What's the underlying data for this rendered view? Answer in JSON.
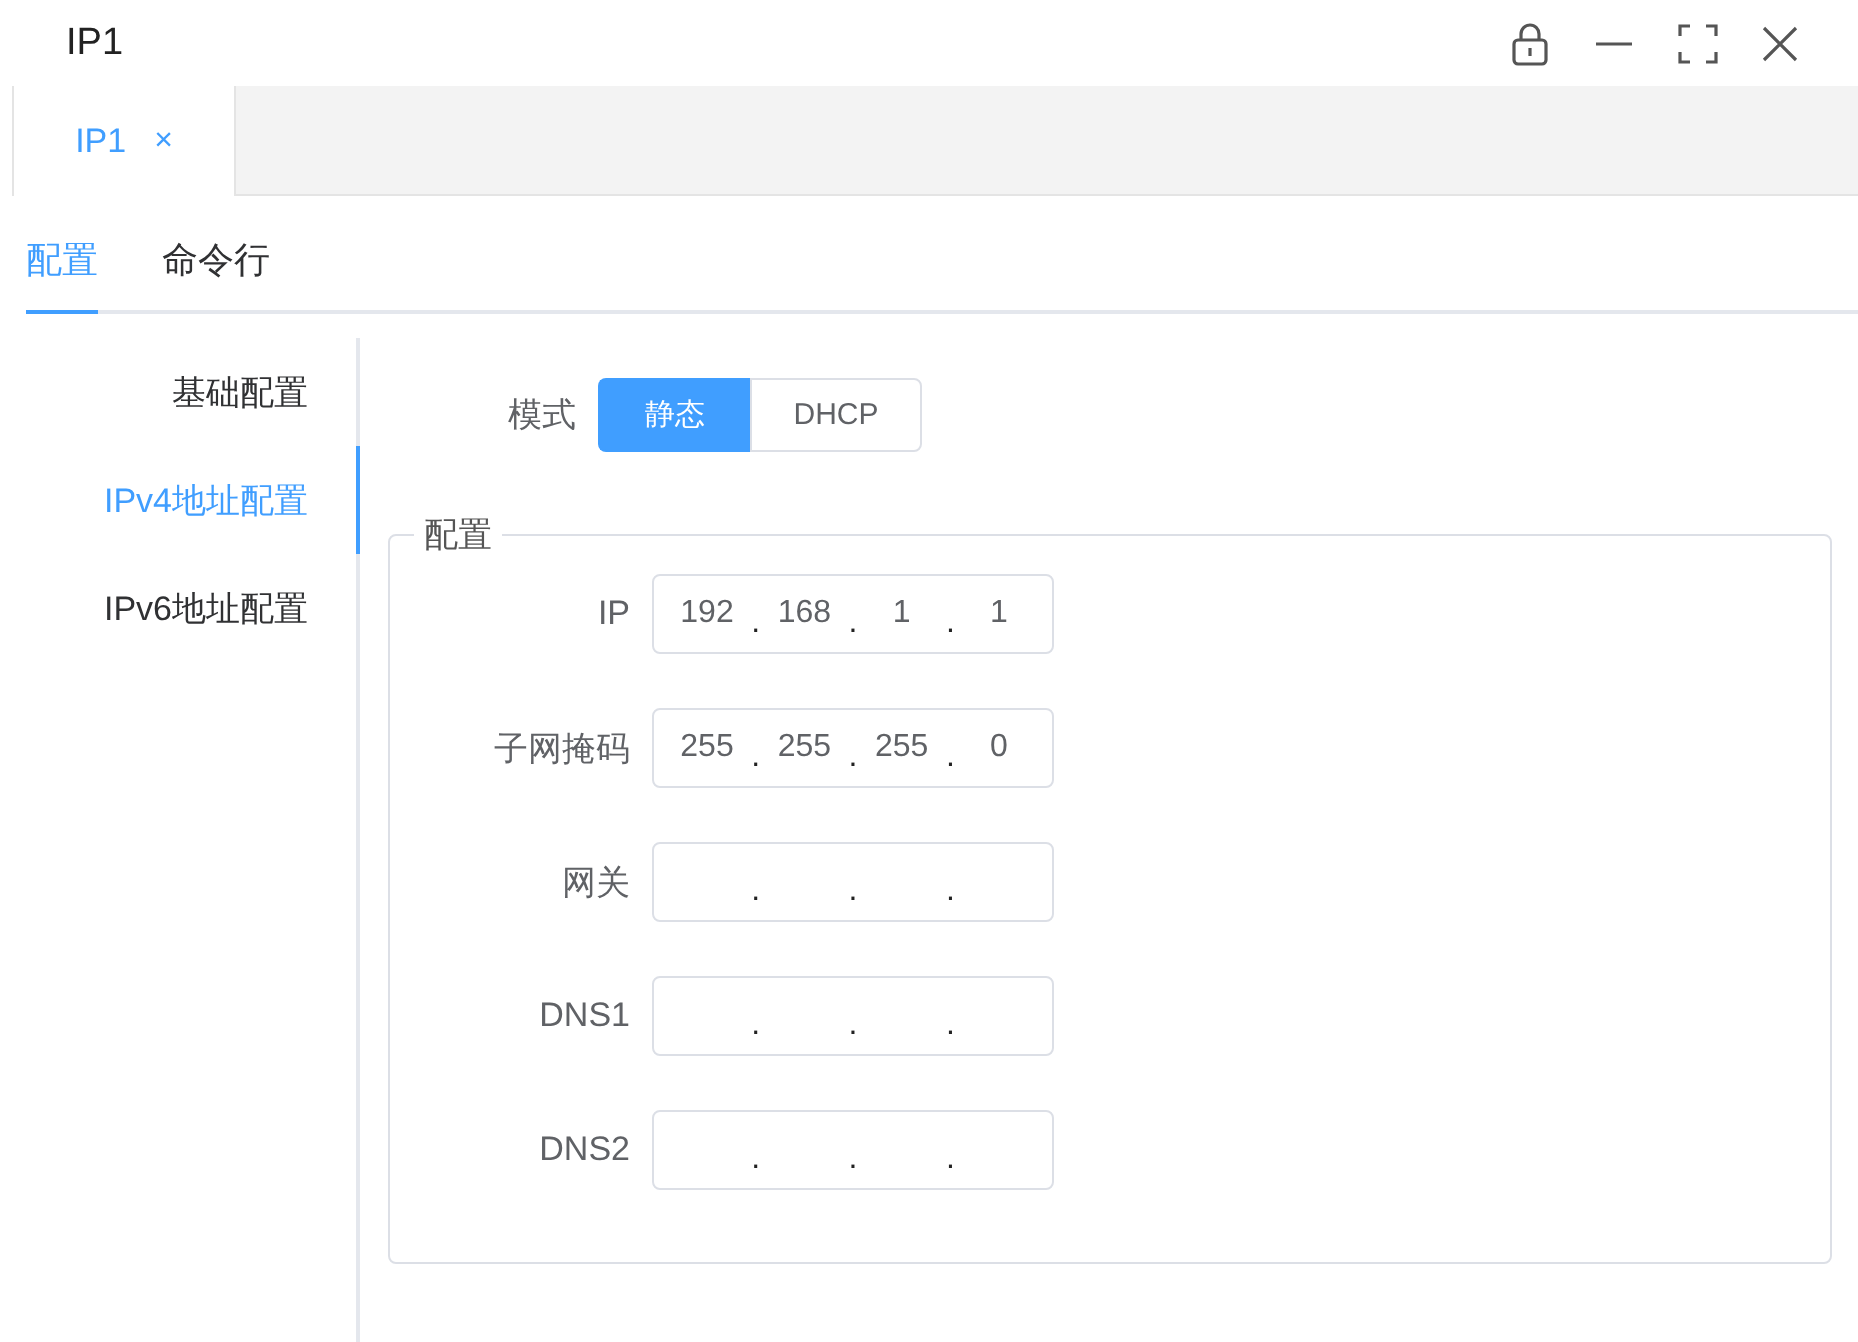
{
  "window": {
    "title": "IP1"
  },
  "doc_tabs": [
    {
      "label": "IP1",
      "close": "×",
      "selected": true
    }
  ],
  "tabs": [
    {
      "label": "配置",
      "selected": true
    },
    {
      "label": "命令行",
      "selected": false
    }
  ],
  "sidebar": {
    "items": [
      {
        "label": "基础配置",
        "selected": false
      },
      {
        "label": "IPv4地址配置",
        "selected": true
      },
      {
        "label": "IPv6地址配置",
        "selected": false
      }
    ]
  },
  "mode": {
    "label": "模式",
    "options": [
      {
        "label": "静态",
        "selected": true
      },
      {
        "label": "DHCP",
        "selected": false
      }
    ]
  },
  "config": {
    "legend": "配置",
    "fields": [
      {
        "label": "IP",
        "octets": [
          "192",
          "168",
          "1",
          "1"
        ],
        "separators": [
          ".",
          ".",
          "."
        ]
      },
      {
        "label": "子网掩码",
        "octets": [
          "255",
          "255",
          "255",
          "0"
        ],
        "separators": [
          ".",
          ".",
          "."
        ]
      },
      {
        "label": "网关",
        "separators": [
          ".",
          ".",
          "."
        ]
      },
      {
        "label": "DNS1",
        "separators": [
          ".",
          ".",
          "."
        ]
      },
      {
        "label": "DNS2",
        "separators": [
          ".",
          ".",
          "."
        ]
      }
    ]
  }
}
